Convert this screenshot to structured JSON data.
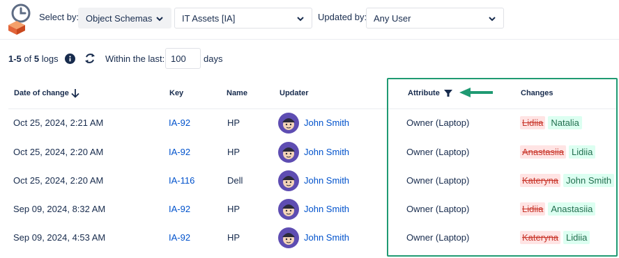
{
  "toolbar": {
    "select_by_label": "Select by:",
    "select_by_value": "Object Schemas",
    "schema_value": "IT Assets [IA]",
    "updated_by_label": "Updated by:",
    "updated_by_value": "Any User"
  },
  "filter_row": {
    "range": "1-5",
    "of_word": "of",
    "total": "5",
    "logs_word": "logs",
    "within_label": "Within the last:",
    "days_value": "100",
    "days_label": "days"
  },
  "table": {
    "headers": {
      "date": "Date of change",
      "key": "Key",
      "name": "Name",
      "updater": "Updater",
      "attribute": "Attribute",
      "changes": "Changes"
    },
    "rows": [
      {
        "date": "Oct 25, 2024, 2:21 AM",
        "key": "IA-92",
        "name": "HP",
        "updater": "John Smith",
        "attribute": "Owner (Laptop)",
        "old": "Lidiia",
        "new": "Natalia"
      },
      {
        "date": "Oct 25, 2024, 2:20 AM",
        "key": "IA-92",
        "name": "HP",
        "updater": "John Smith",
        "attribute": "Owner (Laptop)",
        "old": "Anastasiia",
        "new": "Lidiia"
      },
      {
        "date": "Oct 25, 2024, 2:20 AM",
        "key": "IA-116",
        "name": "Dell",
        "updater": "John Smith",
        "attribute": "Owner (Laptop)",
        "old": "Kateryna",
        "new": "John Smith"
      },
      {
        "date": "Sep 09, 2024, 8:32 AM",
        "key": "IA-92",
        "name": "HP",
        "updater": "John Smith",
        "attribute": "Owner (Laptop)",
        "old": "Lidiia",
        "new": "Anastasiia"
      },
      {
        "date": "Sep 09, 2024, 4:53 AM",
        "key": "IA-92",
        "name": "HP",
        "updater": "John Smith",
        "attribute": "Owner (Laptop)",
        "old": "Kateryna",
        "new": "Lidiia"
      }
    ]
  },
  "colors": {
    "link": "#0052cc",
    "highlight": "#1f9a72",
    "old_bg": "#ffe4e4",
    "new_bg": "#dcfff1"
  },
  "icons": [
    "history-logo-icon",
    "chevron-down-icon",
    "info-icon",
    "refresh-icon",
    "sort-arrow-down-icon",
    "filter-funnel-icon",
    "annotation-arrow-icon",
    "user-avatar-icon"
  ]
}
